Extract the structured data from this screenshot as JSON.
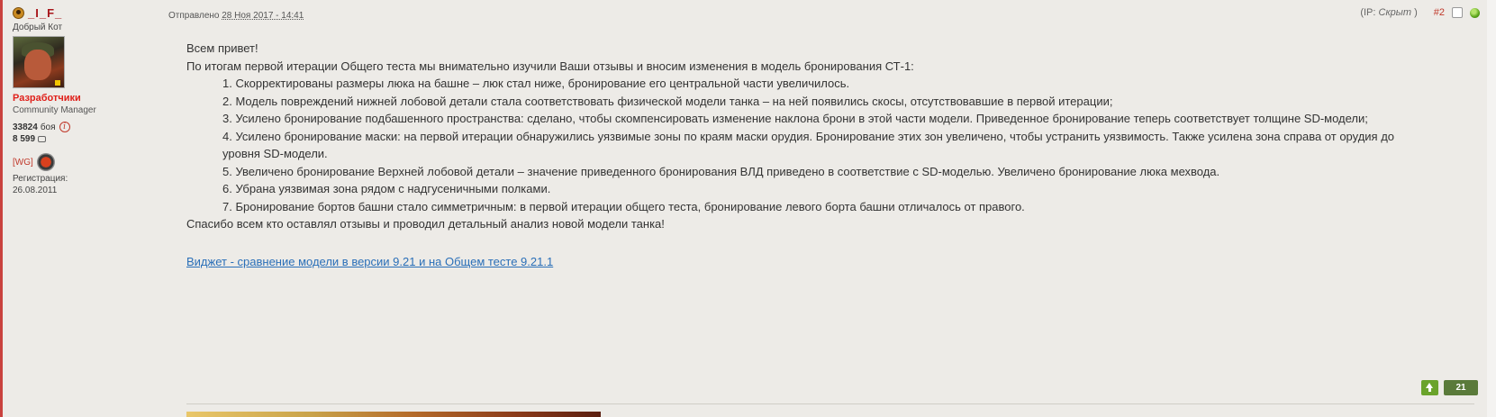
{
  "author": {
    "name": "_I_F_",
    "title": "Добрый Кот",
    "group": "Разработчики",
    "role": "Community Manager",
    "battles_count": "33824",
    "battles_label": "боя",
    "posts_count": "8 599",
    "clan_tag": "[WG]",
    "registration_label": "Регистрация:",
    "registration_date": "26.08.2011"
  },
  "post": {
    "sent_label": "Отправлено",
    "date": "28 Ноя 2017 - 14:41",
    "ip_prefix": "(IP:",
    "ip_value": "Скрыт",
    "ip_suffix": ")",
    "number": "#2",
    "greeting": "Всем привет!",
    "intro": "По итогам первой итерации Общего теста мы внимательно изучили Ваши отзывы и вносим изменения в модель бронирования СТ-1:",
    "changes": [
      "1. Скорректированы размеры люка на башне – люк стал ниже, бронирование его центральной части увеличилось.",
      "2. Модель повреждений нижней лобовой детали стала соответствовать физической модели танка – на ней появились скосы, отсутствовавшие в первой итерации;",
      "3. Усилено бронирование подбашенного пространства: сделано, чтобы скомпенсировать изменение наклона брони в этой части модели. Приведенное бронирование теперь соответствует толщине SD-модели;",
      "4. Усилено бронирование маски: на первой итерации обнаружились уязвимые зоны по краям маски орудия. Бронирование этих зон увеличено, чтобы устранить уязвимость. Также усилена зона справа от орудия до уровня SD-модели.",
      "5. Увеличено бронирование Верхней лобовой детали – значение приведенного бронирования ВЛД приведено в соответствие с SD-моделью. Увеличено бронирование люка мехвода.",
      "6. Убрана уязвимая зона рядом с надгусеничными полками.",
      "7. Бронирование бортов башни стало симметричным: в первой итерации общего теста, бронирование левого борта башни отличалось от правого."
    ],
    "thanks": "Спасибо всем кто оставлял отзывы и проводил детальный анализ новой модели танка!",
    "widget_link": "Виджет - сравнение модели в версии 9.21 и на Общем тесте 9.21.1",
    "reputation": "21"
  },
  "colors": {
    "accent_red": "#c0392b",
    "link_blue": "#2a6fb8",
    "vote_green": "#6aa32b"
  },
  "icons": {
    "status": "user-status-icon",
    "info": "info-icon",
    "comment": "comment-icon",
    "clan": "clan-emblem-icon",
    "online": "online-indicator-icon",
    "vote": "vote-up-arrow-icon"
  }
}
